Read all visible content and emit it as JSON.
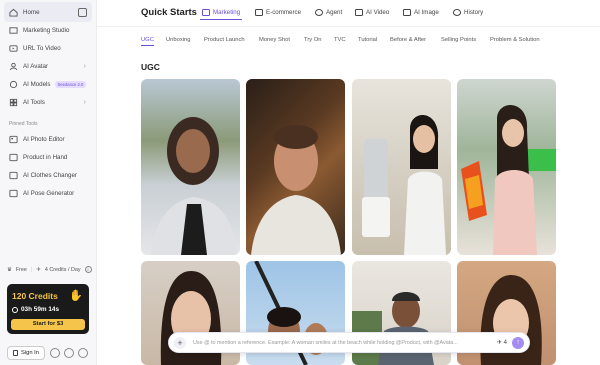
{
  "sidebar": {
    "items": [
      {
        "label": "Home",
        "icon": "home-icon"
      },
      {
        "label": "Marketing Studio",
        "icon": "marketing-icon"
      },
      {
        "label": "URL To Video",
        "icon": "link-icon"
      },
      {
        "label": "AI Avatar",
        "icon": "avatar-icon"
      },
      {
        "label": "AI Models",
        "icon": "models-icon",
        "badge": "Seedance 2.0"
      },
      {
        "label": "AI Tools",
        "icon": "tools-icon"
      }
    ],
    "pinned_label": "Pinned Tools",
    "pinned": [
      {
        "label": "AI Photo Editor",
        "icon": "photo-editor-icon"
      },
      {
        "label": "Product in Hand",
        "icon": "hand-icon"
      },
      {
        "label": "AI Clothes Changer",
        "icon": "clothes-icon"
      },
      {
        "label": "AI Pose Generator",
        "icon": "pose-icon"
      }
    ],
    "plan": "Free",
    "credits_per_day": "4 Credits / Day",
    "credits_card": {
      "title": "120 Credits",
      "timer": "03h 59m 14s",
      "button": "Start for $3"
    },
    "sign_in": "Sign In"
  },
  "header": {
    "title": "Quick Starts",
    "tabs": [
      "Marketing",
      "E-commerce",
      "Agent",
      "AI Video",
      "AI Image",
      "History"
    ],
    "active_tab": "Marketing"
  },
  "subtabs": [
    "UGC",
    "Unboxing",
    "Product Launch",
    "Money Shot",
    "Try On",
    "TVC",
    "Tutorial",
    "Before & After",
    "Selling Points",
    "Problem & Solution"
  ],
  "section_title": "UGC",
  "prompt": {
    "placeholder": "Use @ to mention a reference. Example: A woman smiles at the beach while holding @Product, with @Avata...",
    "count": "4"
  },
  "colors": {
    "accent": "#6a4fd6",
    "credits_gold": "#f5c44a"
  }
}
